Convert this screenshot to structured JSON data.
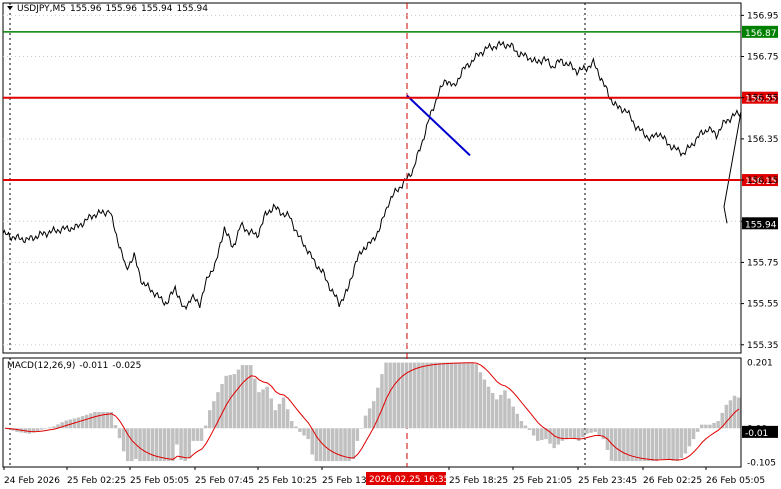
{
  "chart": {
    "symbol": "USDJPY,M5",
    "ohlc": [
      "155.96",
      "155.96",
      "155.94",
      "155.94"
    ],
    "menu_icon": "menu-triangle-icon",
    "colors": {
      "background": "#ffffff",
      "price_line": "#000000",
      "level_red": "#e00000",
      "level_green": "#008000",
      "trend_line": "#0000d0",
      "session_line": "#d00000",
      "macd_histogram": "#c0c0c0",
      "macd_signal": "#e00000",
      "current_price_box": "#000000"
    }
  },
  "chart_data": {
    "type": "line",
    "price_axis": {
      "ticks": [
        "156.95",
        "156.75",
        "156.55",
        "156.35",
        "156.15",
        "155.95",
        "155.75",
        "155.55",
        "155.35"
      ],
      "ylim": [
        155.31,
        157.01
      ]
    },
    "levels": [
      {
        "label": "156.87",
        "value": 156.87,
        "color": "#008000"
      },
      {
        "label": "156.55",
        "value": 156.55,
        "color": "#e00000"
      },
      {
        "label": "156.15",
        "value": 156.15,
        "color": "#e00000"
      }
    ],
    "current_price": {
      "label": "155.94",
      "value": 155.94
    },
    "time_axis": {
      "labels": [
        "24 Feb 2026",
        "25 Feb 02:25",
        "25 Feb 05:05",
        "25 Feb 07:45",
        "25 Feb 10:25",
        "25 Feb 13:",
        "25 Feb 18:25",
        "25 Feb 21:05",
        "25 Feb 23:45",
        "26 Feb 02:25",
        "26 Feb 05:05"
      ],
      "highlight_label": "2026.02.25 16:35",
      "bars": 180
    },
    "price_anchors": [
      [
        0,
        155.89
      ],
      [
        3,
        155.87
      ],
      [
        6,
        155.86
      ],
      [
        10,
        155.89
      ],
      [
        14,
        155.91
      ],
      [
        18,
        155.92
      ],
      [
        22,
        155.98
      ],
      [
        26,
        156.0
      ],
      [
        28,
        155.86
      ],
      [
        30,
        155.72
      ],
      [
        32,
        155.78
      ],
      [
        34,
        155.65
      ],
      [
        36,
        155.62
      ],
      [
        38,
        155.58
      ],
      [
        40,
        155.55
      ],
      [
        42,
        155.63
      ],
      [
        44,
        155.52
      ],
      [
        46,
        155.58
      ],
      [
        48,
        155.55
      ],
      [
        50,
        155.68
      ],
      [
        52,
        155.75
      ],
      [
        54,
        155.92
      ],
      [
        56,
        155.82
      ],
      [
        58,
        155.93
      ],
      [
        60,
        155.9
      ],
      [
        62,
        155.88
      ],
      [
        64,
        155.98
      ],
      [
        66,
        156.02
      ],
      [
        68,
        155.99
      ],
      [
        70,
        155.97
      ],
      [
        72,
        155.88
      ],
      [
        74,
        155.82
      ],
      [
        76,
        155.75
      ],
      [
        78,
        155.7
      ],
      [
        80,
        155.62
      ],
      [
        82,
        155.55
      ],
      [
        84,
        155.61
      ],
      [
        86,
        155.75
      ],
      [
        88,
        155.82
      ],
      [
        90,
        155.85
      ],
      [
        92,
        155.92
      ],
      [
        94,
        156.04
      ],
      [
        96,
        156.1
      ],
      [
        98,
        156.14
      ],
      [
        100,
        156.2
      ],
      [
        102,
        156.32
      ],
      [
        104,
        156.45
      ],
      [
        106,
        156.56
      ],
      [
        108,
        156.64
      ],
      [
        110,
        156.6
      ],
      [
        112,
        156.68
      ],
      [
        114,
        156.72
      ],
      [
        116,
        156.76
      ],
      [
        118,
        156.79
      ],
      [
        120,
        156.8
      ],
      [
        122,
        156.81
      ],
      [
        124,
        156.8
      ],
      [
        126,
        156.76
      ],
      [
        128,
        156.75
      ],
      [
        130,
        156.72
      ],
      [
        132,
        156.74
      ],
      [
        134,
        156.7
      ],
      [
        136,
        156.73
      ],
      [
        138,
        156.71
      ],
      [
        140,
        156.68
      ],
      [
        142,
        156.69
      ],
      [
        144,
        156.72
      ],
      [
        146,
        156.64
      ],
      [
        148,
        156.55
      ],
      [
        150,
        156.5
      ],
      [
        152,
        156.49
      ],
      [
        154,
        156.42
      ],
      [
        156,
        156.38
      ],
      [
        158,
        156.35
      ],
      [
        160,
        156.38
      ],
      [
        162,
        156.33
      ],
      [
        164,
        156.3
      ],
      [
        166,
        156.28
      ],
      [
        168,
        156.32
      ],
      [
        170,
        156.37
      ],
      [
        172,
        156.4
      ],
      [
        174,
        156.37
      ],
      [
        176,
        156.43
      ],
      [
        178,
        156.46
      ],
      [
        180,
        156.48
      ]
    ],
    "macd": {
      "label": "MACD(12,26,9)",
      "main": -0.011,
      "signal": -0.025,
      "ticks": [
        "0.201",
        "0.00",
        "-0.105"
      ],
      "ylim": [
        -0.118,
        0.214
      ]
    }
  }
}
